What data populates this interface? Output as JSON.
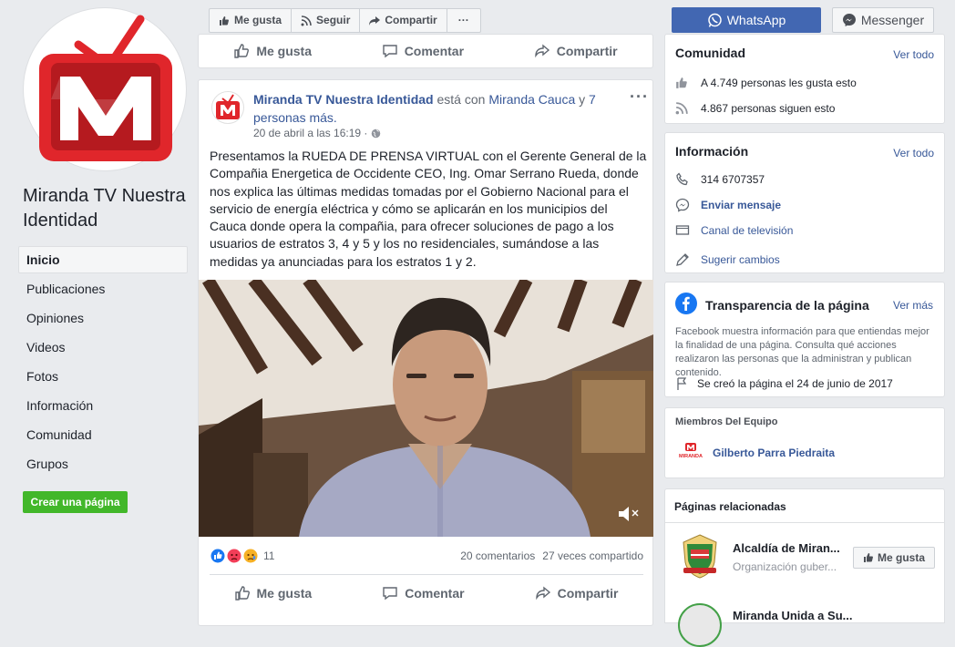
{
  "page": {
    "name": "Miranda TV Nuestra Identidad"
  },
  "nav": {
    "items": [
      "Inicio",
      "Publicaciones",
      "Opiniones",
      "Videos",
      "Fotos",
      "Información",
      "Comunidad",
      "Grupos"
    ],
    "create_page": "Crear una página"
  },
  "topbar": {
    "like": "Me gusta",
    "follow": "Seguir",
    "share": "Compartir",
    "more": "···",
    "whatsapp": "WhatsApp",
    "messenger": "Messenger"
  },
  "actions": {
    "like": "Me gusta",
    "comment": "Comentar",
    "share": "Compartir"
  },
  "post": {
    "author": "Miranda TV Nuestra Identidad",
    "with_text": "está con",
    "tagged": "Miranda Cauca",
    "and_text": "y",
    "others": "7 personas más.",
    "date": "20 de abril a las 16:19 ·",
    "more": "···",
    "text": "Presentamos la RUEDA DE PRENSA VIRTUAL con el Gerente General de la Compañia Energetica de Occidente CEO, Ing. Omar Serrano Rueda, donde nos explica las últimas medidas tomadas por el Gobierno Nacional para el servicio de energía eléctrica y cómo se aplicarán en los municipios del Cauca donde opera la compañia, para ofrecer soluciones de pago a los usuarios de estratos 3, 4 y 5 y los no residenciales, sumándose a las medidas ya anunciadas para los estratos 1 y 2.",
    "reactions_count": "11",
    "comments": "20 comentarios",
    "shares": "27 veces compartido"
  },
  "community": {
    "title": "Comunidad",
    "see_all": "Ver todo",
    "likes": "A 4.749 personas les gusta esto",
    "followers": "4.867 personas siguen esto"
  },
  "info": {
    "title": "Información",
    "see_all": "Ver todo",
    "phone": "314 6707357",
    "message": "Enviar mensaje",
    "category": "Canal de televisión",
    "suggest": "Sugerir cambios"
  },
  "transparency": {
    "title": "Transparencia de la página",
    "see_more": "Ver más",
    "desc": "Facebook muestra información para que entiendas mejor la finalidad de una página. Consulta qué acciones realizaron las personas que la administran y publican contenido.",
    "created": "Se creó la página el 24 de junio de 2017"
  },
  "team": {
    "title": "Miembros Del Equipo",
    "member": "Gilberto Parra Piedraita",
    "logo_text": "MIRANDA"
  },
  "related": {
    "title": "Páginas relacionadas",
    "items": [
      {
        "name": "Alcaldía de Miran...",
        "category": "Organización guber...",
        "button": "Me gusta"
      },
      {
        "name": "Miranda Unida a Su..."
      }
    ]
  },
  "colors": {
    "fb_blue": "#4267b2",
    "link": "#385898",
    "green": "#42b72a",
    "brand_red": "#e0262b"
  }
}
